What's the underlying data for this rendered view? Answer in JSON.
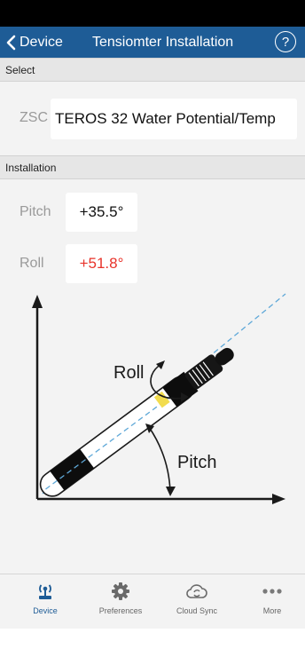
{
  "nav": {
    "back_label": "Device",
    "title": "Tensiomter Installation",
    "help_glyph": "?"
  },
  "select_section": {
    "header": "Select",
    "field_label": "ZSC",
    "sensor_name": "TEROS 32 Water Potential/Temp"
  },
  "installation_section": {
    "header": "Installation",
    "pitch": {
      "label": "Pitch",
      "value": "+35.5°",
      "color": "#111111"
    },
    "roll": {
      "label": "Roll",
      "value": "+51.8°",
      "color": "#e8332a"
    }
  },
  "diagram": {
    "roll_label": "Roll",
    "pitch_label": "Pitch",
    "axis_color": "#1a1a1a",
    "guide_color": "#5fa8d8",
    "indicator_color": "#f2dc4e"
  },
  "tabs": [
    {
      "label": "Device",
      "icon": "device-antenna-icon",
      "active": true
    },
    {
      "label": "Preferences",
      "icon": "gear-icon",
      "active": false
    },
    {
      "label": "Cloud Sync",
      "icon": "cloud-sync-icon",
      "active": false
    },
    {
      "label": "More",
      "icon": "more-dots-icon",
      "active": false
    }
  ],
  "colors": {
    "nav_background": "#1e5c96",
    "active_tab": "#1e5c96",
    "inactive_tab": "#666666"
  }
}
